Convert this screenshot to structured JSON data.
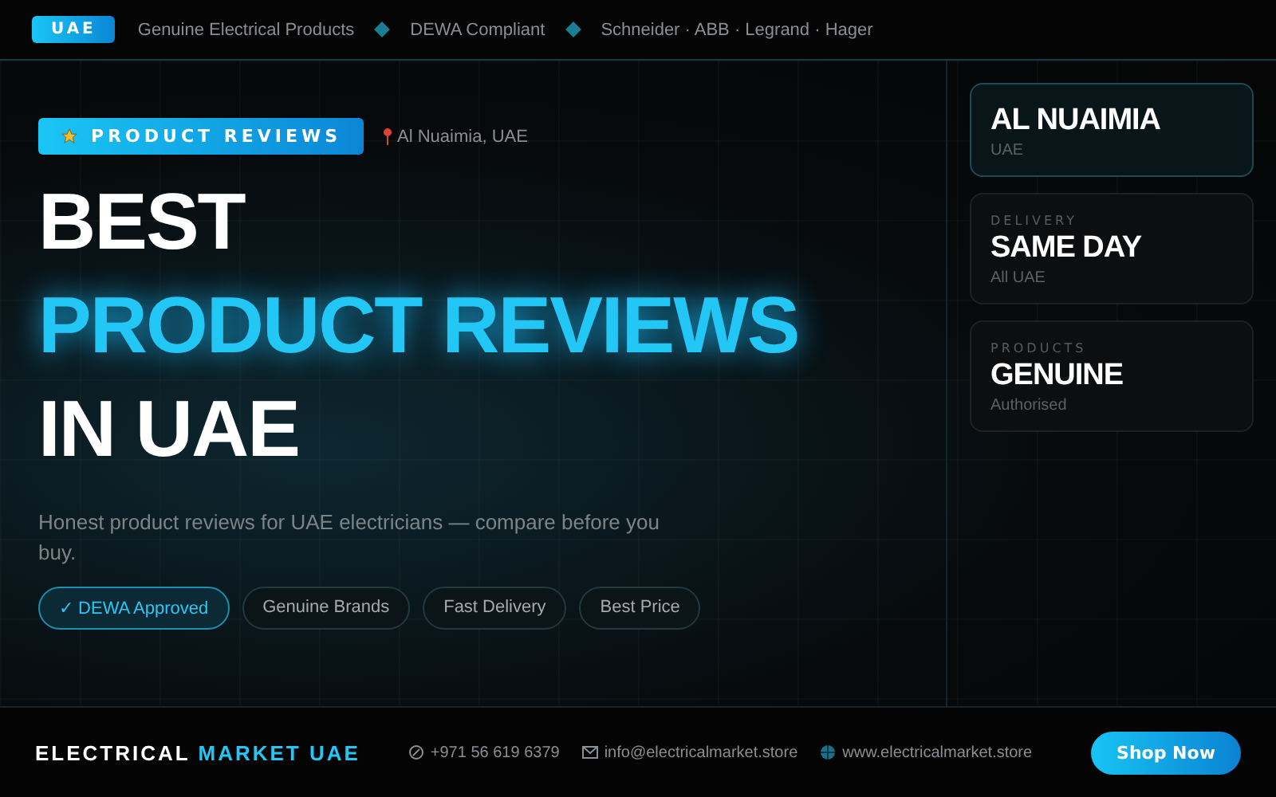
{
  "top_bar": {
    "badge": "UAE",
    "items": [
      "Genuine Electrical Products",
      "DEWA Compliant",
      "Schneider · ABB · Legrand · Hager"
    ]
  },
  "hero": {
    "tag": "PRODUCT REVIEWS",
    "location": "Al Nuaimia, UAE",
    "headline": [
      {
        "text": "BEST",
        "accent": false
      },
      {
        "text": "PRODUCT REVIEWS",
        "accent": true
      },
      {
        "text": "IN UAE",
        "accent": false
      }
    ],
    "description": "Honest product reviews for UAE electricians — compare before you buy.",
    "chips": [
      {
        "label": "✓ DEWA Approved",
        "selected": true
      },
      {
        "label": "Genuine Brands",
        "selected": false
      },
      {
        "label": "Fast Delivery",
        "selected": false
      },
      {
        "label": "Best Price",
        "selected": false
      }
    ]
  },
  "cards": [
    {
      "title": "AL NUAIMIA",
      "subtitle": "UAE",
      "highlighted": true
    },
    {
      "label": "DELIVERY",
      "title": "SAME DAY",
      "subtitle": "All UAE",
      "highlighted": false
    },
    {
      "label": "PRODUCTS",
      "title": "GENUINE",
      "subtitle": "Authorised",
      "highlighted": false
    }
  ],
  "footer": {
    "brand": "ELECTRICAL",
    "brand_accent": "MARKET UAE",
    "phone": "+971 56 619 6379",
    "email": "info@electricalmarket.store",
    "website": "www.electricalmarket.store",
    "button": "Shop Now"
  }
}
